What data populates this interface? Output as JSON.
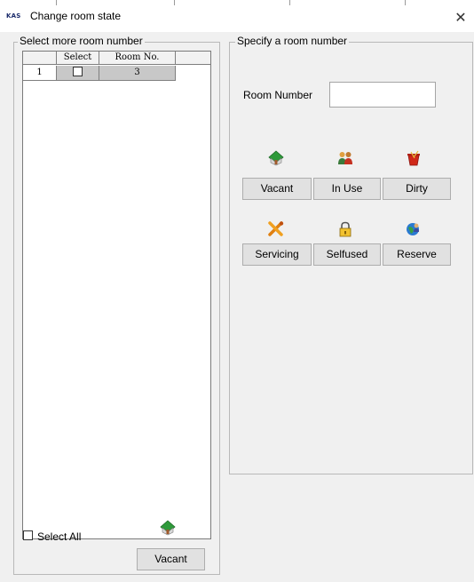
{
  "window": {
    "app_logo": "KAS",
    "title": "Change room state",
    "close_glyph": "✕"
  },
  "left_group": {
    "title": "Select more room number",
    "grid": {
      "columns": [
        "",
        "Select",
        "Room No."
      ],
      "rows": [
        {
          "index": "1",
          "selected": false,
          "room_no": "3"
        }
      ]
    },
    "select_all_label": "Select All",
    "vacant_button": {
      "label": "Vacant",
      "icon": "house-icon"
    }
  },
  "right_group": {
    "title": "Specify a room number",
    "room_number_label": "Room Number",
    "room_number_value": "",
    "buttons": [
      {
        "label": "Vacant",
        "icon": "house-icon"
      },
      {
        "label": "In Use",
        "icon": "people-icon"
      },
      {
        "label": "Dirty",
        "icon": "trash-icon"
      },
      {
        "label": "Servicing",
        "icon": "tools-icon"
      },
      {
        "label": "Selfused",
        "icon": "lock-icon"
      },
      {
        "label": "Reserve",
        "icon": "globe-user-icon"
      }
    ]
  }
}
